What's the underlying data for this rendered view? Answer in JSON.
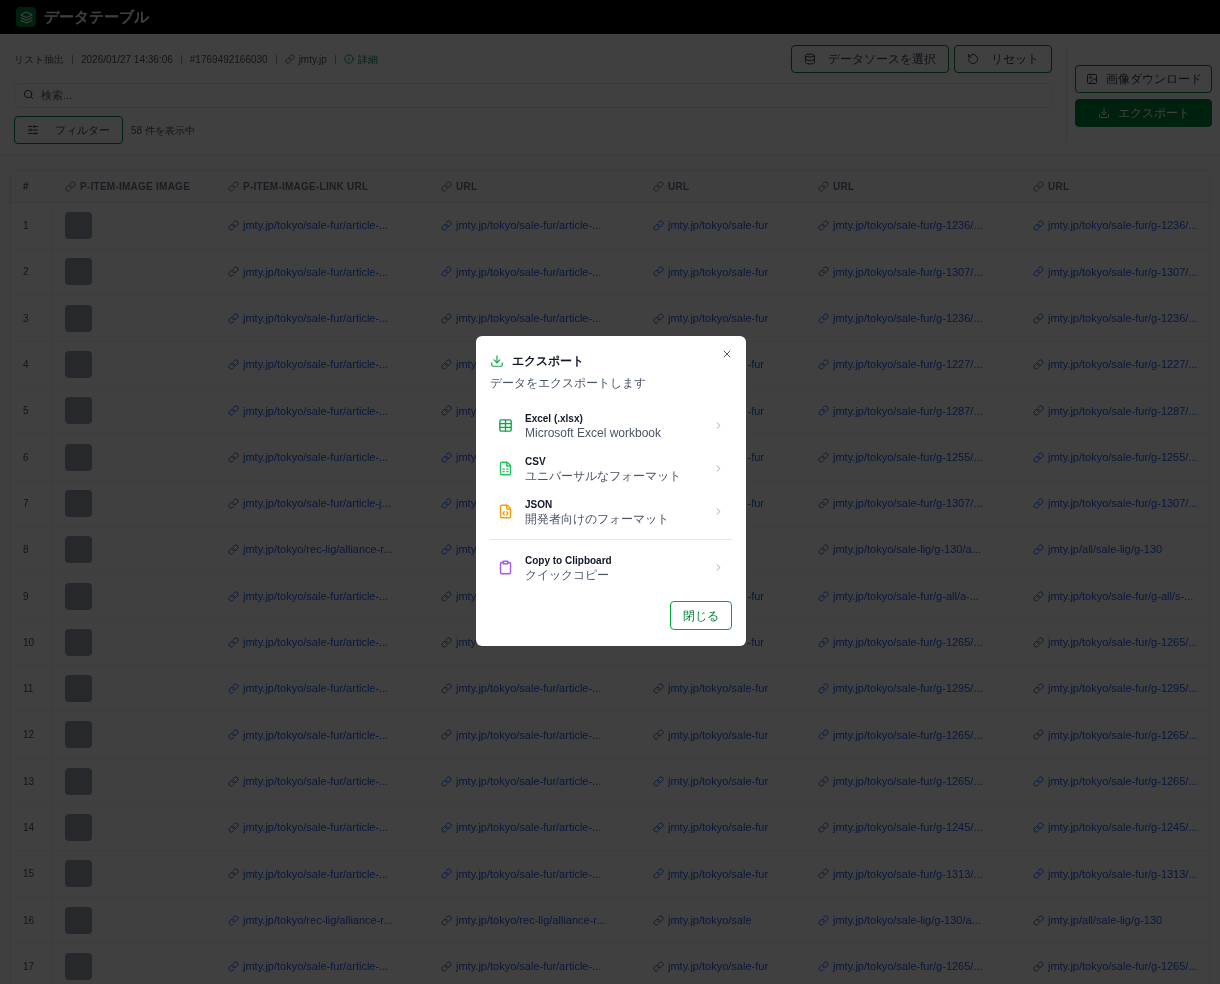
{
  "app_bar": {
    "title": "データテーブル"
  },
  "meta": [
    {
      "kind": "text",
      "text": "リスト抽出"
    },
    {
      "kind": "text",
      "text": "2026/01/27 14:36:06"
    },
    {
      "kind": "text",
      "text": "#1769492166030"
    },
    {
      "kind": "link",
      "text": "jmty.jp"
    },
    {
      "kind": "info",
      "text": "詳細"
    }
  ],
  "toolbar_buttons": [
    {
      "kind": "database",
      "label": "データソースを選択"
    },
    {
      "kind": "reset",
      "label": "リセット"
    }
  ],
  "side_buttons": [
    {
      "kind": "image",
      "label": "画像ダウンロード",
      "primary": false
    },
    {
      "kind": "download",
      "label": "エクスポート",
      "primary": true
    }
  ],
  "search": {
    "placeholder": "検索..."
  },
  "filter_button": "フィルター",
  "count": "58 件を表示中",
  "table": {
    "columns": [
      {
        "label": "#",
        "link": false
      },
      {
        "label": "P-ITEM-IMAGE IMAGE",
        "link": true
      },
      {
        "label": "P-ITEM-IMAGE-LINK URL",
        "link": true
      },
      {
        "label": "URL",
        "link": true
      },
      {
        "label": "URL",
        "link": true
      },
      {
        "label": "URL",
        "link": true
      },
      {
        "label": "URL",
        "link": true
      }
    ],
    "rows": [
      {
        "number": "1",
        "links": {
          "column_2": {
            "text": "jmty.jp/tokyo/sale-fur/article-..."
          },
          "column_3": {
            "text": "jmty.jp/tokyo/sale-fur/article-..."
          },
          "column_4": {
            "text": "jmty.jp/tokyo/sale-fur"
          },
          "column_5": {
            "text": "jmty.jp/tokyo/sale-fur/g-1236/..."
          },
          "column_6": {
            "text": "jmty.jp/tokyo/sale-fur/g-1236/..."
          }
        }
      },
      {
        "number": "2",
        "links": {
          "column_2": {
            "text": "jmty.jp/tokyo/sale-fur/article-..."
          },
          "column_3": {
            "text": "jmty.jp/tokyo/sale-fur/article-..."
          },
          "column_4": {
            "text": "jmty.jp/tokyo/sale-fur"
          },
          "column_5": {
            "text": "jmty.jp/tokyo/sale-fur/g-1307/..."
          },
          "column_6": {
            "text": "jmty.jp/tokyo/sale-fur/g-1307/..."
          }
        }
      },
      {
        "number": "3",
        "links": {
          "column_2": {
            "text": "jmty.jp/tokyo/sale-fur/article-..."
          },
          "column_3": {
            "text": "jmty.jp/tokyo/sale-fur/article-..."
          },
          "column_4": {
            "text": "jmty.jp/tokyo/sale-fur"
          },
          "column_5": {
            "text": "jmty.jp/tokyo/sale-fur/g-1236/..."
          },
          "column_6": {
            "text": "jmty.jp/tokyo/sale-fur/g-1236/..."
          }
        }
      },
      {
        "number": "4",
        "links": {
          "column_2": {
            "text": "jmty.jp/tokyo/sale-fur/article-..."
          },
          "column_3": {
            "text": "jmty"
          },
          "column_4": {
            "text": "-fur",
            "cut_left": true
          },
          "column_5": {
            "text": "jmty.jp/tokyo/sale-fur/g-1227/..."
          },
          "column_6": {
            "text": "jmty.jp/tokyo/sale-fur/g-1227/..."
          }
        }
      },
      {
        "number": "5",
        "links": {
          "column_2": {
            "text": "jmty.jp/tokyo/sale-fur/article-..."
          },
          "column_3": {
            "text": "jmty"
          },
          "column_4": {
            "text": "-fur",
            "cut_left": true
          },
          "column_5": {
            "text": "jmty.jp/tokyo/sale-fur/g-1287/..."
          },
          "column_6": {
            "text": "jmty.jp/tokyo/sale-fur/g-1287/..."
          }
        }
      },
      {
        "number": "6",
        "links": {
          "column_2": {
            "text": "jmty.jp/tokyo/sale-fur/article-..."
          },
          "column_3": {
            "text": "jmty"
          },
          "column_4": {
            "text": "-fur",
            "cut_left": true
          },
          "column_5": {
            "text": "jmty.jp/tokyo/sale-fur/g-1255/..."
          },
          "column_6": {
            "text": "jmty.jp/tokyo/sale-fur/g-1255/..."
          }
        }
      },
      {
        "number": "7",
        "links": {
          "column_2": {
            "text": "jmty.jp/tokyo/sale-fur/article-j..."
          },
          "column_3": {
            "text": "jmty"
          },
          "column_4": {
            "text": "-fur",
            "cut_left": true
          },
          "column_5": {
            "text": "jmty.jp/tokyo/sale-fur/g-1307/..."
          },
          "column_6": {
            "text": "jmty.jp/tokyo/sale-fur/g-1307/..."
          }
        }
      },
      {
        "number": "8",
        "links": {
          "column_2": {
            "text": "jmty.jp/tokyo/rec-lig/alliance-r..."
          },
          "column_3": {
            "text": "jmty"
          },
          "column_5": {
            "text": "jmty.jp/tokyo/sale-lig/g-130/a..."
          },
          "column_6": {
            "text": "jmty.jp/all/sale-lig/g-130"
          }
        }
      },
      {
        "number": "9",
        "links": {
          "column_2": {
            "text": "jmty.jp/tokyo/sale-fur/article-..."
          },
          "column_3": {
            "text": "jmty"
          },
          "column_4": {
            "text": "-fur",
            "cut_left": true
          },
          "column_5": {
            "text": "jmty.jp/tokyo/sale-fur/g-all/a-..."
          },
          "column_6": {
            "text": "jmty.jp/tokyo/sale-fur/g-all/s-..."
          }
        }
      },
      {
        "number": "10",
        "links": {
          "column_2": {
            "text": "jmty.jp/tokyo/sale-fur/article-..."
          },
          "column_3": {
            "text": "jmty"
          },
          "column_4": {
            "text": "-fur",
            "cut_left": true
          },
          "column_5": {
            "text": "jmty.jp/tokyo/sale-fur/g-1265/..."
          },
          "column_6": {
            "text": "jmty.jp/tokyo/sale-fur/g-1265/..."
          }
        }
      },
      {
        "number": "11",
        "links": {
          "column_2": {
            "text": "jmty.jp/tokyo/sale-fur/article-..."
          },
          "column_3": {
            "text": "jmty.jp/tokyo/sale-fur/article-..."
          },
          "column_4": {
            "text": "jmty.jp/tokyo/sale-fur"
          },
          "column_5": {
            "text": "jmty.jp/tokyo/sale-fur/g-1295/..."
          },
          "column_6": {
            "text": "jmty.jp/tokyo/sale-fur/g-1295/..."
          }
        }
      },
      {
        "number": "12",
        "links": {
          "column_2": {
            "text": "jmty.jp/tokyo/sale-fur/article-..."
          },
          "column_3": {
            "text": "jmty.jp/tokyo/sale-fur/article-..."
          },
          "column_4": {
            "text": "jmty.jp/tokyo/sale-fur"
          },
          "column_5": {
            "text": "jmty.jp/tokyo/sale-fur/g-1265/..."
          },
          "column_6": {
            "text": "jmty.jp/tokyo/sale-fur/g-1265/..."
          }
        }
      },
      {
        "number": "13",
        "links": {
          "column_2": {
            "text": "jmty.jp/tokyo/sale-fur/article-..."
          },
          "column_3": {
            "text": "jmty.jp/tokyo/sale-fur/article-..."
          },
          "column_4": {
            "text": "jmty.jp/tokyo/sale-fur"
          },
          "column_5": {
            "text": "jmty.jp/tokyo/sale-fur/g-1265/..."
          },
          "column_6": {
            "text": "jmty.jp/tokyo/sale-fur/g-1265/..."
          }
        }
      },
      {
        "number": "14",
        "links": {
          "column_2": {
            "text": "jmty.jp/tokyo/sale-fur/article-..."
          },
          "column_3": {
            "text": "jmty.jp/tokyo/sale-fur/article-..."
          },
          "column_4": {
            "text": "jmty.jp/tokyo/sale-fur"
          },
          "column_5": {
            "text": "jmty.jp/tokyo/sale-fur/g-1245/..."
          },
          "column_6": {
            "text": "jmty.jp/tokyo/sale-fur/g-1245/..."
          }
        }
      },
      {
        "number": "15",
        "links": {
          "column_2": {
            "text": "jmty.jp/tokyo/sale-fur/article-..."
          },
          "column_3": {
            "text": "jmty.jp/tokyo/sale-fur/article-..."
          },
          "column_4": {
            "text": "jmty.jp/tokyo/sale-fur"
          },
          "column_5": {
            "text": "jmty.jp/tokyo/sale-fur/g-1313/..."
          },
          "column_6": {
            "text": "jmty.jp/tokyo/sale-fur/g-1313/..."
          }
        }
      },
      {
        "number": "16",
        "links": {
          "column_2": {
            "text": "jmty.jp/tokyo/rec-lig/alliance-r..."
          },
          "column_3": {
            "text": "jmty.jp/tokyo/rec-lig/alliance-r..."
          },
          "column_4": {
            "text": "jmty.jp/tokyo/sale"
          },
          "column_5": {
            "text": "jmty.jp/tokyo/sale-lig/g-130/a..."
          },
          "column_6": {
            "text": "jmty.jp/all/sale-lig/g-130"
          }
        }
      },
      {
        "number": "17",
        "links": {
          "column_2": {
            "text": "jmty.jp/tokyo/sale-fur/article-..."
          },
          "column_3": {
            "text": "jmty.jp/tokyo/sale-fur/article-..."
          },
          "column_4": {
            "text": "jmty.jp/tokyo/sale-fur"
          },
          "column_5": {
            "text": "jmty.jp/tokyo/sale-fur/g-1265/..."
          },
          "column_6": {
            "text": "jmty.jp/tokyo/sale-fur/g-1265/..."
          }
        }
      }
    ]
  },
  "export_dialog": {
    "title": "エクスポート",
    "subtitle": "データをエクスポートします",
    "options": [
      {
        "kind": "table",
        "title": "Excel (.xlsx)",
        "subtitle": "Microsoft Excel workbook",
        "color": "#16a34a"
      },
      {
        "kind": "sheet",
        "title": "CSV",
        "subtitle": "ユニバーサルなフォーマット",
        "color": "#22c55e"
      },
      {
        "kind": "code",
        "title": "JSON",
        "subtitle": "開発者向けのフォーマット",
        "color": "#f59e0b"
      }
    ],
    "quick_options": [
      {
        "kind": "clipboard",
        "title": "Copy to Clipboard",
        "subtitle": "クイックコピー",
        "color": "#a855f7"
      }
    ],
    "close_button": "閉じる"
  }
}
